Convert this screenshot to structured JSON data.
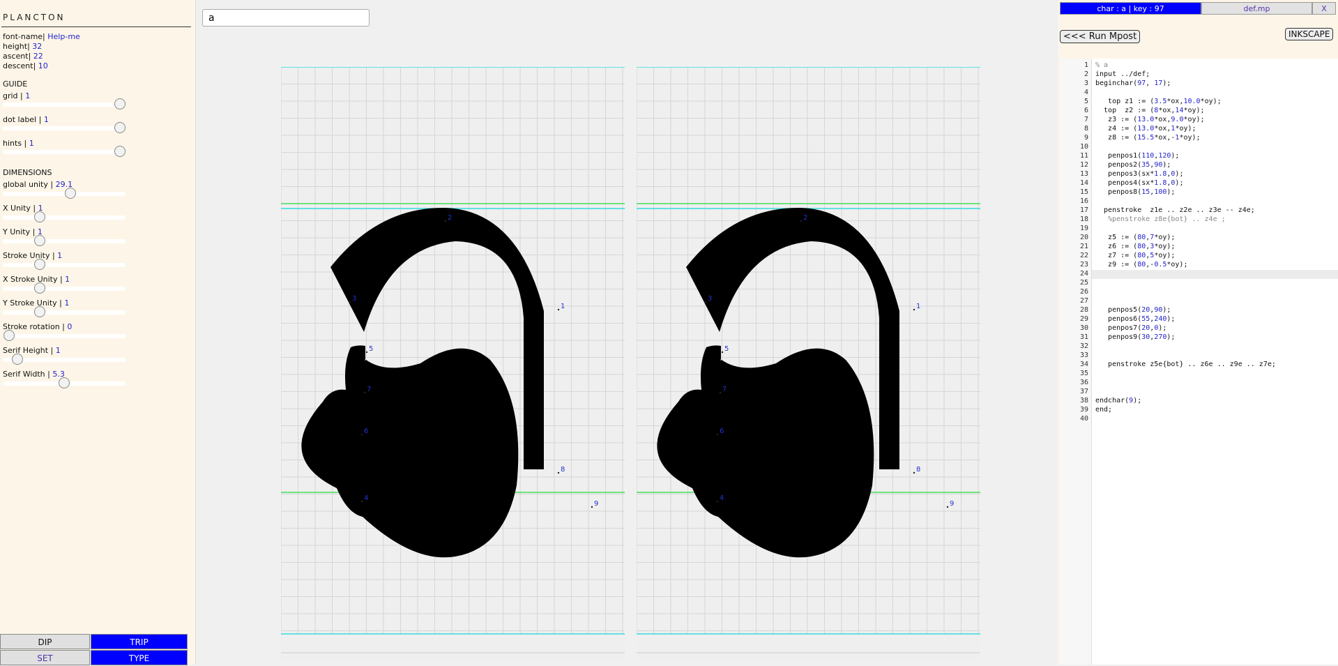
{
  "app": {
    "brand": "PLANCTON"
  },
  "params": {
    "font_name_label": "font-name|",
    "font_name_value": "Help-me",
    "height_label": "height|",
    "height_value": "32",
    "ascent_label": "ascent|",
    "ascent_value": "22",
    "descent_label": "descent|",
    "descent_value": "10"
  },
  "guide": {
    "title": "GUIDE",
    "grid_label": "grid |",
    "grid_value": "1",
    "dot_label_label": "dot label |",
    "dot_label_value": "1",
    "hints_label": "hints |",
    "hints_value": "1"
  },
  "dimensions": {
    "title": "DIMENSIONS",
    "items": [
      {
        "label": "global unity |",
        "value": "29.1",
        "level": 0.55
      },
      {
        "label": "X Unity |",
        "value": "1",
        "level": 0.3
      },
      {
        "label": "Y Unity |",
        "value": "1",
        "level": 0.3
      },
      {
        "label": "Stroke Unity |",
        "value": "1",
        "level": 0.3
      },
      {
        "label": "X Stroke Unity |",
        "value": "1",
        "level": 0.3
      },
      {
        "label": "Y Stroke Unity |",
        "value": "1",
        "level": 0.3
      },
      {
        "label": "Stroke rotation |",
        "value": "0",
        "level": 0.05
      },
      {
        "label": "Serif Height |",
        "value": "1",
        "level": 0.12
      },
      {
        "label": "Serif Width |",
        "value": "5.3",
        "level": 0.5
      }
    ]
  },
  "modes": {
    "dip": "DIP",
    "trip": "TRIP",
    "set": "SET",
    "type": "TYPE"
  },
  "search": {
    "value": "a"
  },
  "point_labels": [
    "2",
    "3",
    "1",
    "5",
    "7",
    "6",
    "4",
    "9",
    "8"
  ],
  "right": {
    "tab_char": "char : a | key : 97",
    "tab_file": "def.mp",
    "tab_close": "X",
    "run_button": "<<< Run Mpost",
    "inkscape_button": "INKSCAPE"
  },
  "code": {
    "lines": [
      "% a",
      "input ../def;",
      "beginchar(97, 17);",
      "",
      "   top z1 := (3.5*ox,10.0*oy);",
      "  top  z2 := (8*ox,14*oy);",
      "   z3 := (13.0*ox,9.0*oy);",
      "   z4 := (13.0*ox,1*oy);",
      "   z8 := (15.5*ox,-1*oy);",
      "",
      "   penpos1(110,120);",
      "   penpos2(35,90);",
      "   penpos3(sx*1.8,0);",
      "   penpos4(sx*1.8,0);",
      "   penpos8(15,100);",
      "",
      "  penstroke  z1e .. z2e .. z3e -- z4e;",
      "   %penstroke z8e{bot} .. z4e ;",
      "",
      "   z5 := (80,7*oy);",
      "   z6 := (80,3*oy);",
      "   z7 := (80,5*oy);",
      "   z9 := (80,-0.5*oy);",
      "",
      "",
      "",
      "",
      "   penpos5(20,90);",
      "   penpos6(55,240);",
      "   penpos7(20,0);",
      "   penpos9(30,270);",
      "",
      "",
      "   penstroke z5e{bot} .. z6e .. z9e .. z7e;",
      "",
      "",
      "",
      "endchar(9);",
      "end;",
      ""
    ],
    "highlight_line": "24"
  },
  "colors": {
    "accent": "#0000ff",
    "number": "#2222cc",
    "cyan_guide": "#33dddd",
    "green_guide": "#44dd55"
  }
}
